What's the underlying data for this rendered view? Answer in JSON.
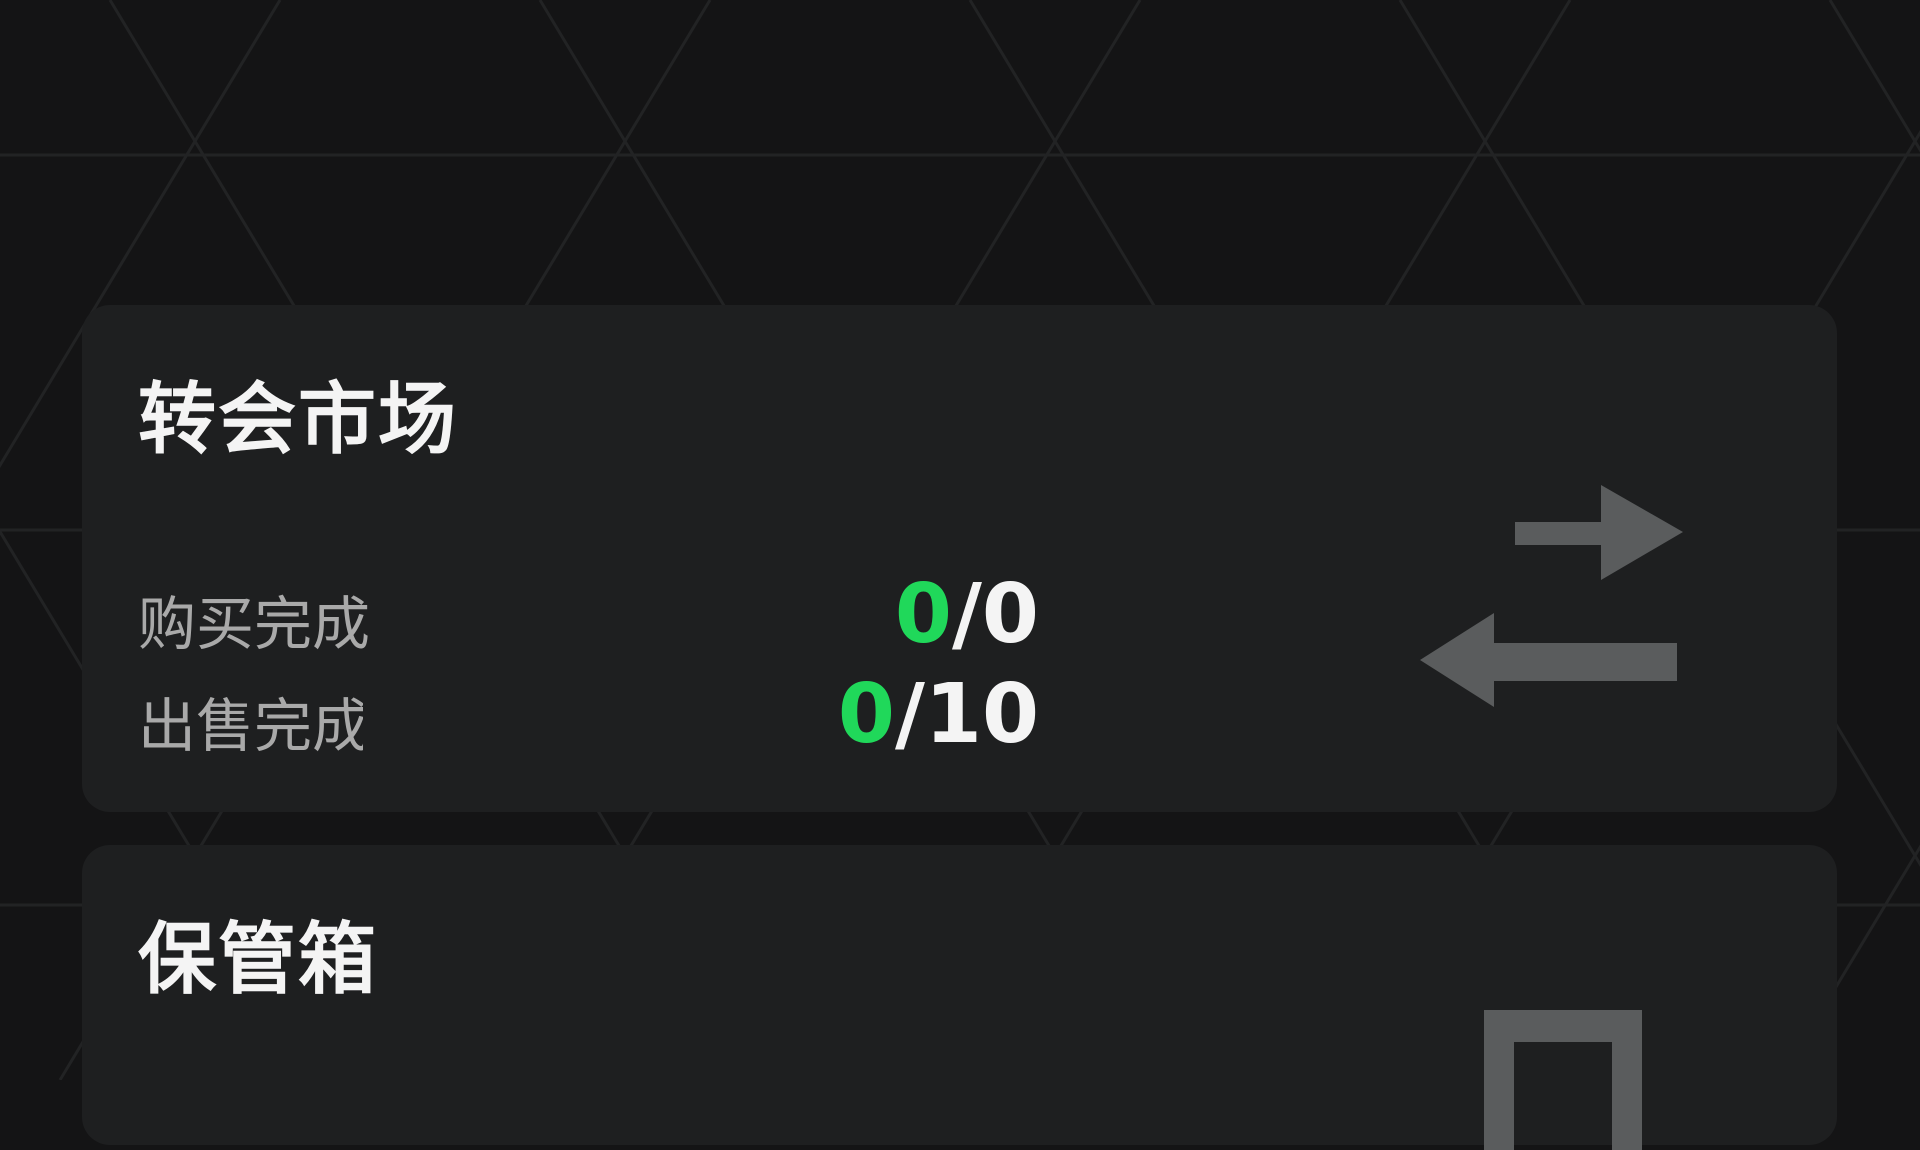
{
  "transfer_market": {
    "title": "转会市场",
    "buy_label": "购买完成",
    "buy_done": "0",
    "buy_total": "/0",
    "sell_label": "出售完成",
    "sell_done": "0",
    "sell_total": "/10"
  },
  "storage_box": {
    "title": "保管箱"
  },
  "colors": {
    "background": "#141415",
    "card": "#1e1f20",
    "accent_green": "#20d85a",
    "icon_gray": "#5a5c5d"
  },
  "icons": {
    "transfer": "swap-arrows-icon",
    "storage": "box-icon"
  }
}
